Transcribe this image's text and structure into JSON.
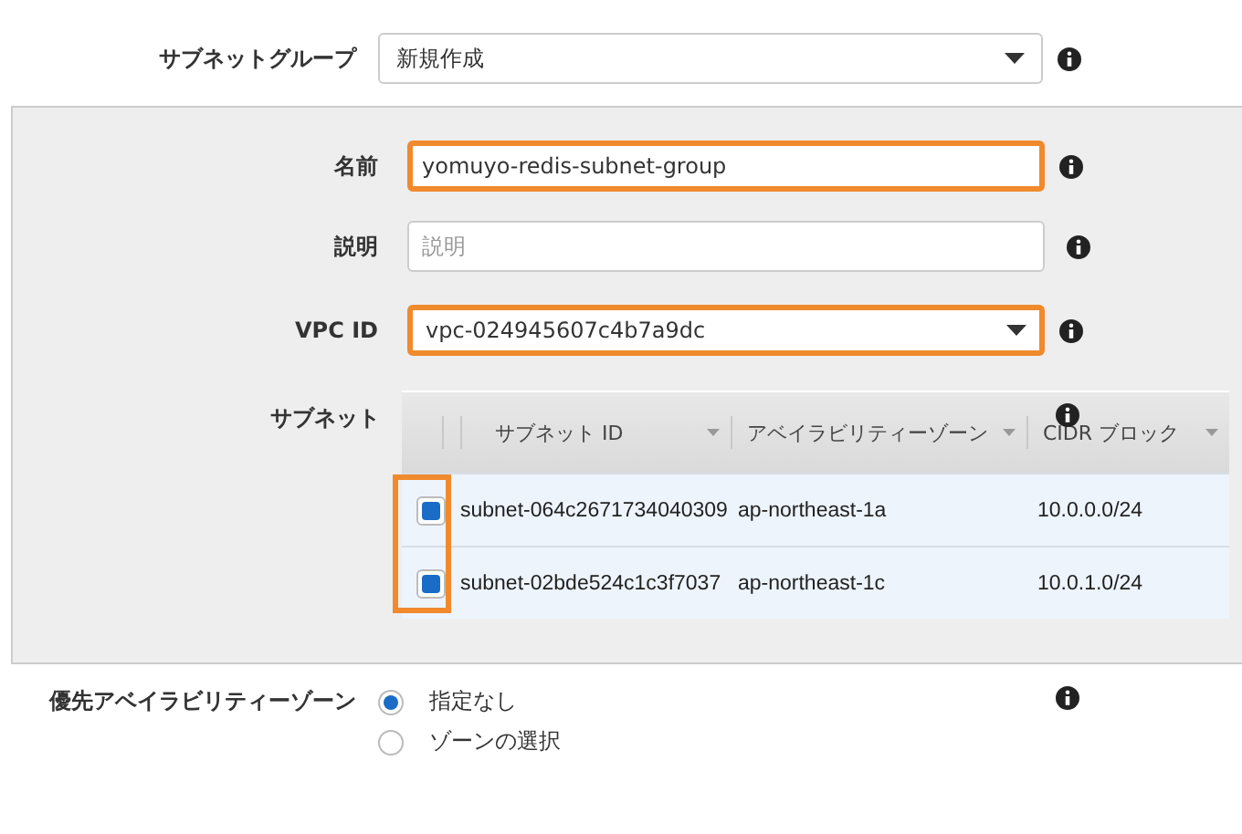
{
  "subnet_group": {
    "label": "サブネットグループ",
    "value": "新規作成"
  },
  "name": {
    "label": "名前",
    "value": "yomuyo-redis-subnet-group",
    "highlighted": true
  },
  "description": {
    "label": "説明",
    "placeholder": "説明",
    "highlighted": false
  },
  "vpc": {
    "label": "VPC ID",
    "value": "vpc-024945607c4b7a9dc",
    "highlighted": true
  },
  "subnets": {
    "label": "サブネット",
    "checkboxes_highlighted": true,
    "columns": [
      "サブネット ID",
      "アベイラビリティーゾーン",
      "CIDR ブロック"
    ],
    "rows": [
      {
        "subnet_id": "subnet-064c2671734040309",
        "zone": "ap-northeast-1a",
        "cidr": "10.0.0.0/24",
        "checked": true
      },
      {
        "subnet_id": "subnet-02bde524c1c3f7037",
        "zone": "ap-northeast-1c",
        "cidr": "10.0.1.0/24",
        "checked": true
      }
    ]
  },
  "preferred_zone": {
    "label": "優先アベイラビリティーゾーン",
    "options": [
      {
        "label": "指定なし",
        "selected": true
      },
      {
        "label": "ゾーンの選択",
        "selected": false
      }
    ]
  }
}
